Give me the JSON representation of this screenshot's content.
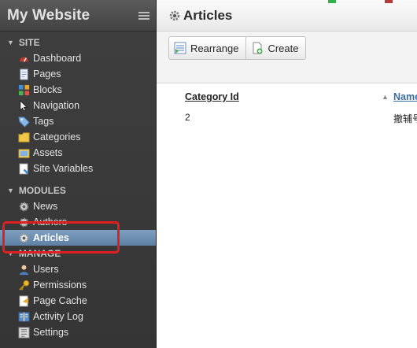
{
  "app": {
    "title": "My Website"
  },
  "sidebar": {
    "sections": [
      {
        "title": "SITE",
        "items": [
          {
            "label": "Dashboard",
            "icon": "dashboard-icon"
          },
          {
            "label": "Pages",
            "icon": "pages-icon"
          },
          {
            "label": "Blocks",
            "icon": "blocks-icon"
          },
          {
            "label": "Navigation",
            "icon": "navigation-icon"
          },
          {
            "label": "Tags",
            "icon": "tag-icon"
          },
          {
            "label": "Categories",
            "icon": "folder-icon"
          },
          {
            "label": "Assets",
            "icon": "assets-icon"
          },
          {
            "label": "Site Variables",
            "icon": "variables-icon"
          }
        ]
      },
      {
        "title": "MODULES",
        "items": [
          {
            "label": "News",
            "icon": "gear-icon"
          },
          {
            "label": "Authors",
            "icon": "gear-icon"
          },
          {
            "label": "Articles",
            "icon": "gear-icon",
            "active": true
          }
        ]
      },
      {
        "title": "MANAGE",
        "items": [
          {
            "label": "Users",
            "icon": "user-icon"
          },
          {
            "label": "Permissions",
            "icon": "key-icon"
          },
          {
            "label": "Page Cache",
            "icon": "cache-icon"
          },
          {
            "label": "Activity Log",
            "icon": "log-icon"
          },
          {
            "label": "Settings",
            "icon": "settings-icon"
          }
        ]
      }
    ]
  },
  "main": {
    "title": "Articles",
    "toolbar": {
      "rearrange_label": "Rearrange",
      "create_label": "Create"
    },
    "table": {
      "columns": [
        "Category Id",
        "Name"
      ],
      "rows": [
        {
          "category_id": "2",
          "name": "撤辅号"
        }
      ]
    }
  },
  "colors": {
    "sidebar_bg": "#3a3a3a",
    "active_item": "#6d8fb3",
    "highlight": "#e02020",
    "link": "#3b6ea5"
  }
}
